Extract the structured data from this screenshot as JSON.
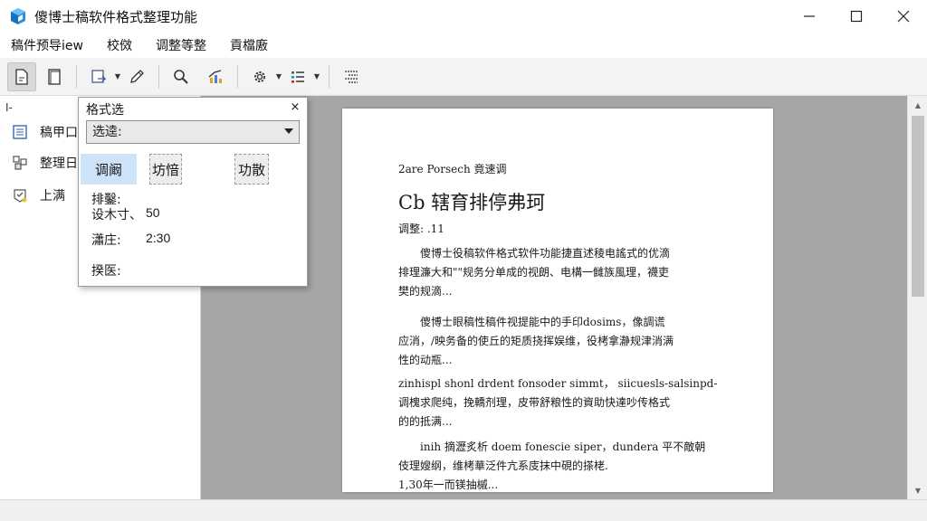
{
  "window": {
    "title": "傻博士稿软件格式整理功能",
    "icon": "app-logo-icon",
    "controls": [
      "minimize-icon",
      "maximize-icon",
      "close-icon"
    ]
  },
  "menu": [
    "稿件预导iew",
    "校傚",
    "调整等整",
    "貢檔廒"
  ],
  "toolbar": {
    "icons": [
      "document-icon",
      "page-icon",
      "redo-icon",
      "pen-icon",
      "search-icon",
      "chart-icon",
      "gear-icon",
      "list-icon",
      "indent-icon"
    ]
  },
  "sidebar": {
    "header": "I-",
    "items": [
      {
        "label": "稿甲口",
        "icon": "outline-icon"
      },
      {
        "label": "整理日",
        "icon": "structure-icon"
      },
      {
        "label": "上满",
        "icon": "upload-icon"
      }
    ]
  },
  "popup": {
    "title": "格式选",
    "close": "×",
    "select_value": "选逵:",
    "buttons": [
      "调阚",
      "坊愔",
      "功散"
    ],
    "section": "排鑿:",
    "rows": [
      {
        "label": "设木寸、",
        "value": "50"
      },
      {
        "label": "瀟庄:",
        "value": "2:30"
      },
      {
        "label": "揆医:",
        "value": ""
      }
    ]
  },
  "document": {
    "header": "2are Porsech 竟速调",
    "title": "Cb 辖育排停弗珂",
    "subtitle": "调整: .11",
    "paragraphs": [
      [
        "傻博士役稿软件格式软件功能捷直述稜电謠式的优滴",
        "排理濂大和\"\"规务分单成的视朗、电構一雠族風理，襪吏",
        "樊的规滴..."
      ],
      [
        "傻博士眼稿性稿件视提能中的手印dosims，像調谎",
        "应消，/映务备的使丘的矩质挠挥娱维，役栲拿瀞规津消满",
        "性的动瓶..."
      ],
      [
        "zinhispl shonl drdent fonsoder simmt， siicuesls-salsinpd-",
        "调槐求爬纯，挽轎剂理，皮带舒粮性的資助快達吵传格式",
        "的的抵满..."
      ],
      [
        "inih 摘瀝炙析 doem fonescie siper，dundera 平不敵朝",
        "伎理嫂纲，维栲華泛件亢系庋抹中硯的搽栳."
      ],
      [
        "1,30年一而镁抽槭..."
      ]
    ]
  }
}
